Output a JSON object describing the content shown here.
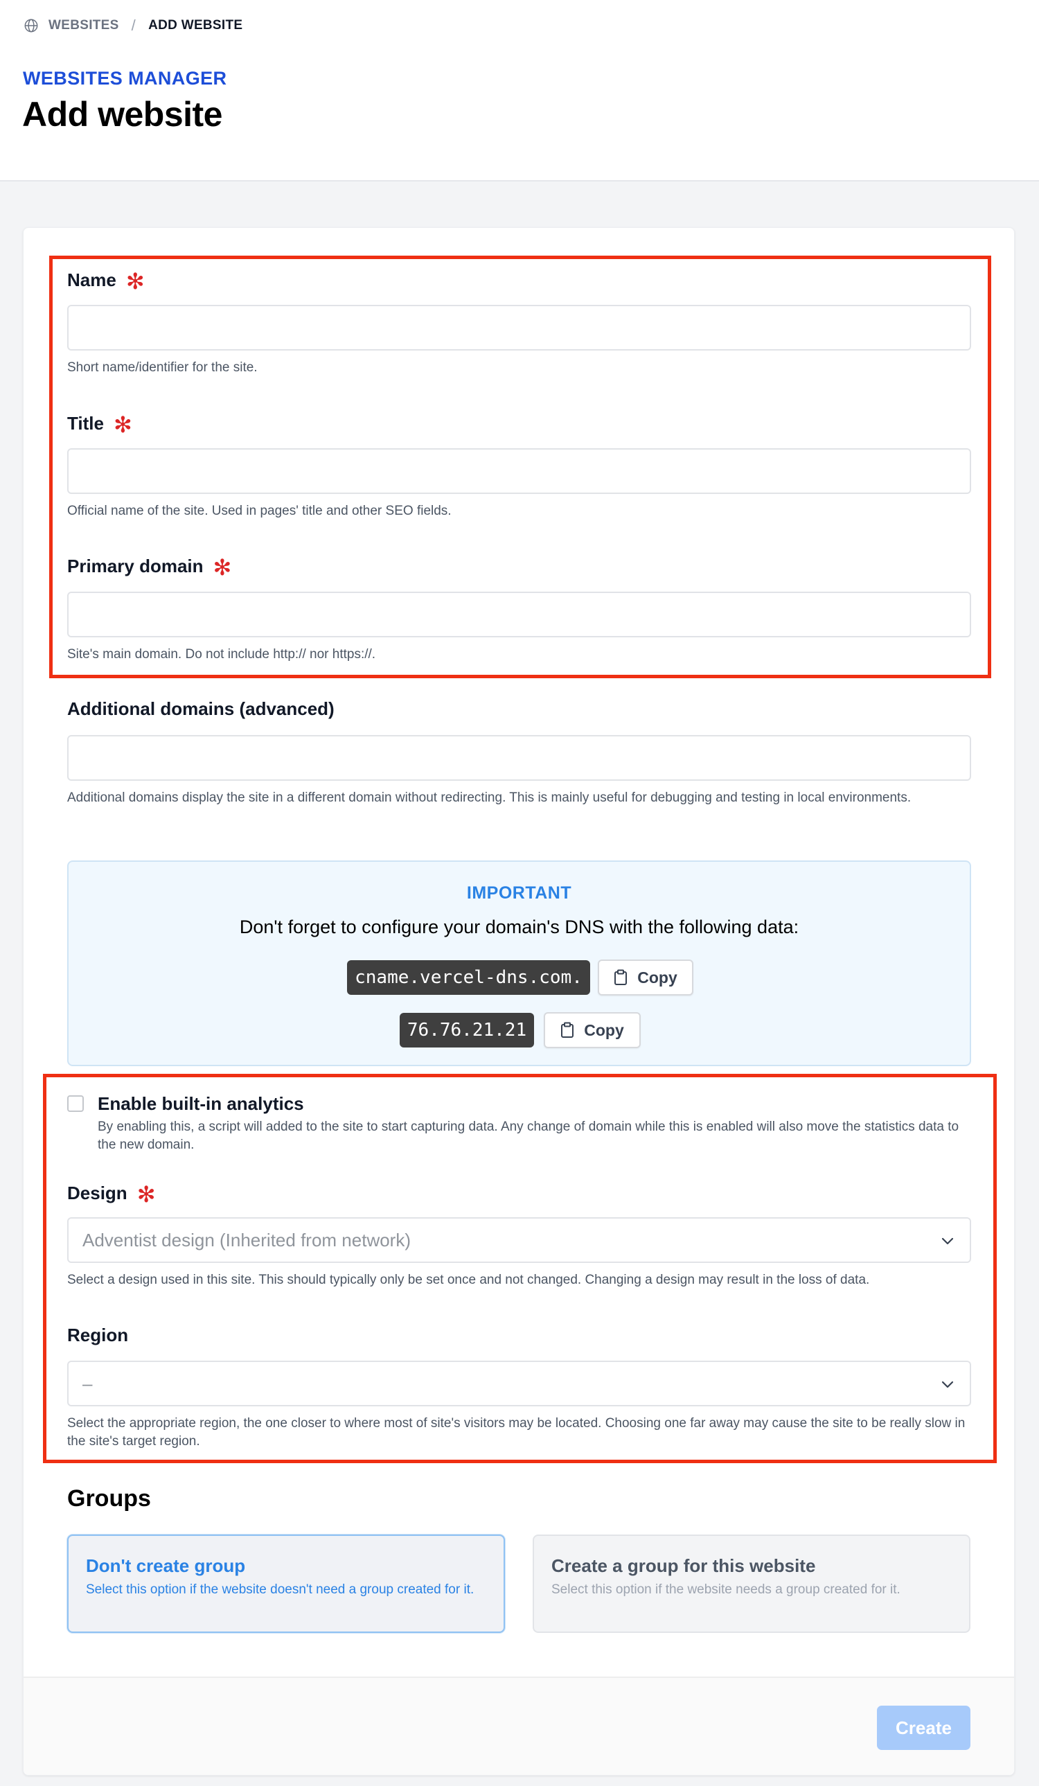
{
  "breadcrumb": {
    "icon": "globe-icon",
    "items": [
      "WEBSITES",
      "ADD WEBSITE"
    ],
    "separator": "/"
  },
  "header": {
    "section": "WEBSITES MANAGER",
    "title": "Add website"
  },
  "form": {
    "name": {
      "label": "Name",
      "required": true,
      "value": "",
      "help": "Short name/identifier for the site."
    },
    "title": {
      "label": "Title",
      "required": true,
      "value": "",
      "help": "Official name of the site. Used in pages' title and other SEO fields."
    },
    "primary_domain": {
      "label": "Primary domain",
      "required": true,
      "value": "",
      "help": "Site's main domain. Do not include http:// nor https://."
    },
    "additional_domains": {
      "label": "Additional domains (advanced)",
      "value": "",
      "help": "Additional domains display the site in a different domain without redirecting. This is mainly useful for debugging and testing in local environments."
    },
    "important": {
      "title": "IMPORTANT",
      "text": "Don't forget to configure your domain's DNS with the following data:",
      "records": [
        {
          "value": "cname.vercel-dns.com.",
          "copy_label": "Copy"
        },
        {
          "value": "76.76.21.21",
          "copy_label": "Copy"
        }
      ]
    },
    "analytics": {
      "label": "Enable built-in analytics",
      "checked": false,
      "help": "By enabling this, a script will added to the site to start capturing data. Any change of domain while this is enabled will also move the statistics data to the new domain."
    },
    "design": {
      "label": "Design",
      "required": true,
      "selected": "Adventist design (Inherited from network)",
      "help": "Select a design used in this site. This should typically only be set once and not changed. Changing a design may result in the loss of data."
    },
    "region": {
      "label": "Region",
      "selected": "–",
      "help": "Select the appropriate region, the one closer to where most of site's visitors may be located. Choosing one far away may cause the site to be really slow in the site's target region."
    }
  },
  "groups": {
    "title": "Groups",
    "options": [
      {
        "title": "Don't create group",
        "desc": "Select this option if the website doesn't need a group created for it.",
        "selected": true
      },
      {
        "title": "Create a group for this website",
        "desc": "Select this option if the website needs a group created for it.",
        "selected": false
      }
    ]
  },
  "footer": {
    "create_label": "Create"
  },
  "colors": {
    "accent": "#2a82e4",
    "section_label": "#1d4ed8",
    "required": "#dc2626",
    "highlight": "#ef2f13",
    "create_disabled": "#a7cafa"
  }
}
